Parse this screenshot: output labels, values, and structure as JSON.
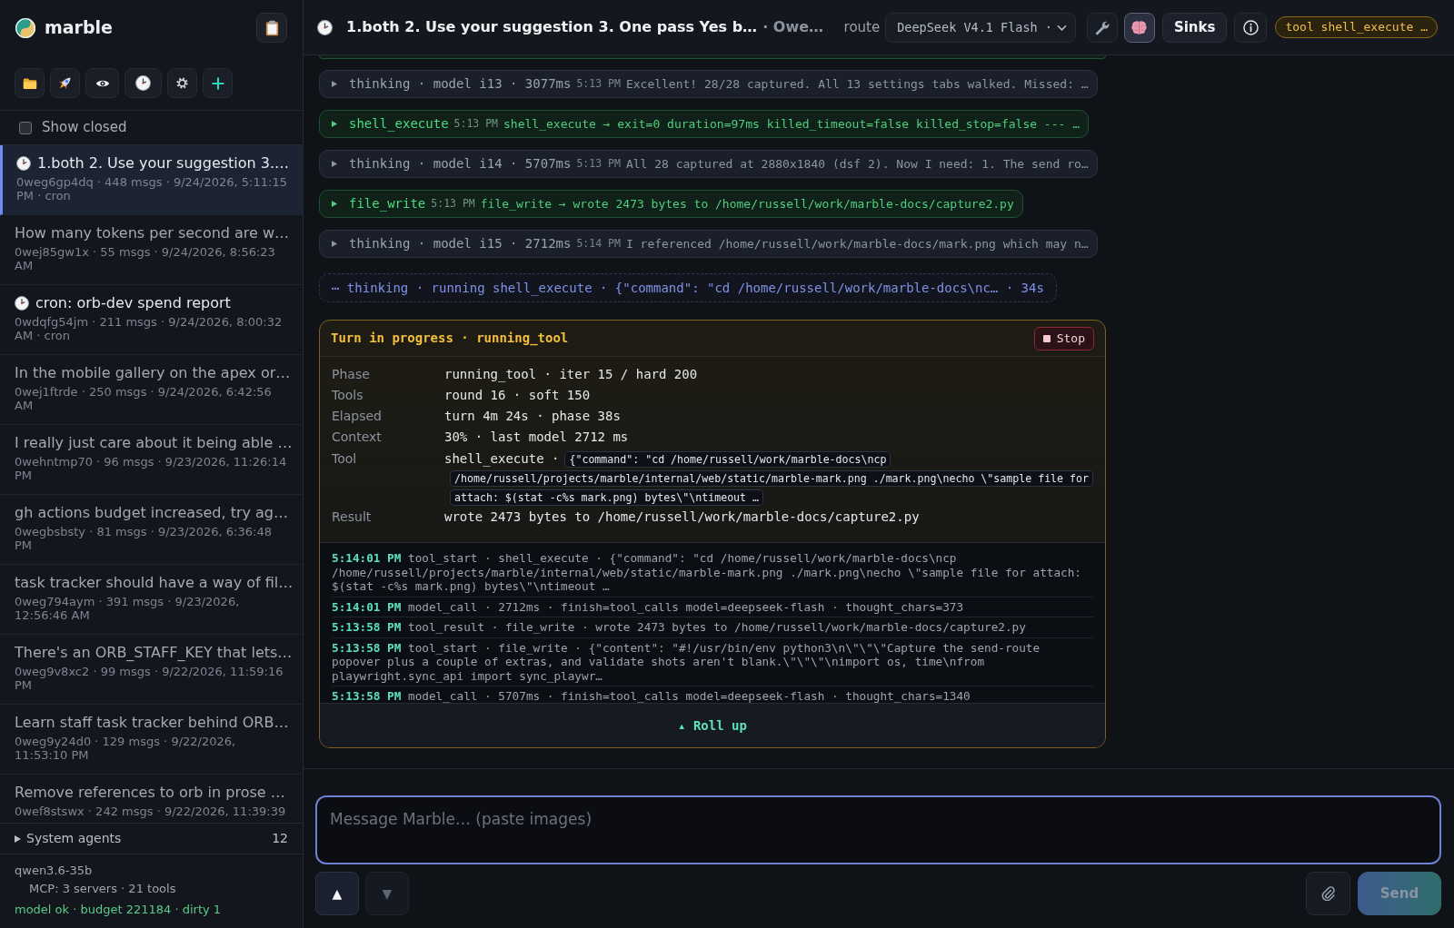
{
  "sidebar": {
    "brand": "marble",
    "show_closed": {
      "label": "Show closed",
      "checked": false
    },
    "conversations": [
      {
        "title": "1.both 2. Use your suggestion 3.…",
        "meta": "0weg6gp4dq · 448 msgs · 9/24/2026, 5:11:15 PM · cron",
        "scheduled": true,
        "selected": true
      },
      {
        "title": "How many tokens per second are w…",
        "meta": "0wej85gw1x · 55 msgs · 9/24/2026, 8:56:23 AM",
        "scheduled": false,
        "selected": false
      },
      {
        "title": "cron: orb-dev spend report",
        "meta": "0wdqfg54jm · 211 msgs · 9/24/2026, 8:00:32 AM · cron",
        "scheduled": true,
        "selected": false
      },
      {
        "title": "In the mobile gallery on the apex or…",
        "meta": "0wej1ftrde · 250 msgs · 9/24/2026, 6:42:56 AM",
        "scheduled": false,
        "selected": false
      },
      {
        "title": "I really just care about it being able …",
        "meta": "0wehntmp70 · 96 msgs · 9/23/2026, 11:26:14 PM",
        "scheduled": false,
        "selected": false
      },
      {
        "title": "gh actions budget increased, try ag…",
        "meta": "0wegbsbsty · 81 msgs · 9/23/2026, 6:36:48 PM",
        "scheduled": false,
        "selected": false
      },
      {
        "title": "task tracker should have a way of fil…",
        "meta": "0weg794aym · 391 msgs · 9/23/2026, 12:56:46 AM",
        "scheduled": false,
        "selected": false
      },
      {
        "title": "There's an ORB_STAFF_KEY that lets…",
        "meta": "0weg9v8xc2 · 99 msgs · 9/22/2026, 11:59:16 PM",
        "scheduled": false,
        "selected": false
      },
      {
        "title": "Learn staff task tracker behind ORB…",
        "meta": "0weg9y24d0 · 129 msgs · 9/22/2026, 11:53:10 PM",
        "scheduled": false,
        "selected": false
      },
      {
        "title": "Remove references to orb in prose …",
        "meta": "0wef8stswx · 242 msgs · 9/22/2026, 11:39:39",
        "scheduled": false,
        "selected": false
      }
    ],
    "system_agents": {
      "label": "System agents",
      "count": "12",
      "expanded": false
    },
    "footer": {
      "model": "qwen3.6-35b",
      "mcp": "MCP: 3 servers · 21 tools",
      "status": "model ok · budget 221184 · dirty 1"
    }
  },
  "header": {
    "title": "1.both 2. Use your suggestion 3. One pass Yes b…",
    "subtitle": "· Owe…",
    "route": {
      "label": "route",
      "value": "DeepSeek V4.1 Flash ·"
    },
    "reasoning_toggle": {
      "on": true
    },
    "sinks": "Sinks",
    "tool_badge": "tool shell_execute …"
  },
  "feed": {
    "entries": [
      {
        "kind": "thinking",
        "label": "thinking · model i13 · 3077ms",
        "time": "5:13 PM",
        "text": "Excellent! 28/28 captured. All 13 settings tabs walked. Missed: …",
        "expanded": false
      },
      {
        "kind": "tool",
        "label": "shell_execute",
        "time": "5:13 PM",
        "text": "shell_execute → exit=0 duration=97ms killed_timeout=false killed_stop=false --- …",
        "expanded": false
      },
      {
        "kind": "thinking",
        "label": "thinking · model i14 · 5707ms",
        "time": "5:13 PM",
        "text": "All 28 captured at 2880x1840 (dsf 2). Now I need: 1. The send ro…",
        "expanded": false
      },
      {
        "kind": "tool",
        "label": "file_write",
        "time": "5:13 PM",
        "text": "file_write → wrote 2473 bytes to /home/russell/work/marble-docs/capture2.py",
        "expanded": false
      },
      {
        "kind": "thinking",
        "label": "thinking · model i15 · 2712ms",
        "time": "5:14 PM",
        "text": "I referenced /home/russell/work/marble-docs/mark.png which may n…",
        "expanded": false
      }
    ],
    "running": "⋯ thinking · running shell_execute · {\"command\": \"cd /home/russell/work/marble-docs\\nc… · 34s"
  },
  "turn": {
    "title": "Turn in progress · running_tool",
    "stop": "Stop",
    "fields": [
      {
        "label": "Phase",
        "value": "running_tool · iter 15 / hard 200"
      },
      {
        "label": "Tools",
        "value": "round 16 · soft 150"
      },
      {
        "label": "Elapsed",
        "value": "turn 4m 24s · phase 38s"
      },
      {
        "label": "Context",
        "value": "30% · last model 2712 ms"
      },
      {
        "label": "Tool",
        "value": "shell_execute ·",
        "code": "{\"command\": \"cd /home/russell/work/marble-docs\\ncp /home/russell/projects/marble/internal/web/static/marble-mark.png ./mark.png\\necho \\\"sample file for attach: $(stat -c%s mark.png) bytes\\\"\\ntimeout …"
      },
      {
        "label": "Result",
        "value": "wrote 2473 bytes to /home/russell/work/marble-docs/capture2.py"
      }
    ],
    "log": [
      {
        "time": "5:14:01 PM",
        "text": "tool_start · shell_execute · {\"command\": \"cd /home/russell/work/marble-docs\\ncp /home/russell/projects/marble/internal/web/static/marble-mark.png ./mark.png\\necho \\\"sample file for attach: $(stat -c%s mark.png) bytes\\\"\\ntimeout …"
      },
      {
        "time": "5:14:01 PM",
        "text": "model_call · 2712ms · finish=tool_calls model=deepseek-flash · thought_chars=373"
      },
      {
        "time": "5:13:58 PM",
        "text": "tool_result · file_write · wrote 2473 bytes to /home/russell/work/marble-docs/capture2.py"
      },
      {
        "time": "5:13:58 PM",
        "text": "tool_start · file_write · {\"content\": \"#!/usr/bin/env python3\\n\\\"\\\"\\\"Capture the send-route popover plus a couple of extras, and validate shots aren't blank.\\\"\\\"\\\"\\nimport os, time\\nfrom playwright.sync_api import sync_playwr…"
      },
      {
        "time": "5:13:58 PM",
        "text": "model_call · 5707ms · finish=tool_calls model=deepseek-flash · thought_chars=1340"
      }
    ],
    "roll_up": "▴ Roll up"
  },
  "composer": {
    "placeholder": "Message Marble… (paste images)",
    "history_up": {
      "label": "▲",
      "disabled": false
    },
    "history_down": {
      "label": "▼",
      "disabled": true
    },
    "send": {
      "label": "Send",
      "disabled": true
    }
  }
}
